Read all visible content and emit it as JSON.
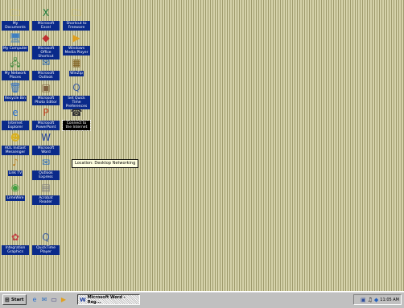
{
  "desktop": {
    "icons": [
      {
        "label": "My Documents",
        "glyph": "🗀",
        "color": "#e8c840"
      },
      {
        "label": "My Computer",
        "glyph": "🖥",
        "color": "#4080c0"
      },
      {
        "label": "My Network Places",
        "glyph": "🖧",
        "color": "#3a8a3a"
      },
      {
        "label": "Recycle Bin",
        "glyph": "🗑",
        "color": "#2b6cc4"
      },
      {
        "label": "Internet Explorer",
        "glyph": "e",
        "color": "#2a6fd0"
      },
      {
        "label": "AOL Instant Messenger",
        "glyph": "☻",
        "color": "#d8b020"
      },
      {
        "label": "Link TV",
        "glyph": "♪",
        "color": "#c08020"
      },
      {
        "label": "LimeWire",
        "glyph": "◉",
        "color": "#40a040"
      },
      {
        "label": "Integration Graphics",
        "glyph": "✿",
        "color": "#c04040"
      },
      {
        "label": "Microsoft Excel",
        "glyph": "X",
        "color": "#1a7a3a"
      },
      {
        "label": "Microsoft Office Shortcut",
        "glyph": "◆",
        "color": "#c03030"
      },
      {
        "label": "Microsoft Outlook",
        "glyph": "✉",
        "color": "#2060b0"
      },
      {
        "label": "Microsoft Photo Editor",
        "glyph": "▣",
        "color": "#806040"
      },
      {
        "label": "Microsoft PowerPoint",
        "glyph": "P",
        "color": "#c04020"
      },
      {
        "label": "Microsoft Word",
        "glyph": "W",
        "color": "#2040a0"
      },
      {
        "label": "Outlook Express",
        "glyph": "✉",
        "color": "#3070c0"
      },
      {
        "label": "Acrobat Reader",
        "glyph": "▤",
        "color": "#808080"
      },
      {
        "label": "QuickTime Player",
        "glyph": "Q",
        "color": "#4060a0"
      },
      {
        "label": "Shortcut to Freeware",
        "glyph": "🗀",
        "color": "#e8c840"
      },
      {
        "label": "Windows Media Player",
        "glyph": "▶",
        "color": "#e0a020"
      },
      {
        "label": "WinZip",
        "glyph": "▦",
        "color": "#806020"
      },
      {
        "label": "Set Quick Time Preferences",
        "glyph": "Q",
        "color": "#4060a0"
      },
      {
        "label": "Connect to the Internet",
        "glyph": "☎",
        "color": "#303030"
      }
    ],
    "tooltip": "Location: Desktop Networking"
  },
  "taskbar": {
    "start_label": "Start",
    "quick_launch": [
      "ie-icon",
      "outlook-icon",
      "desktop-icon",
      "media-icon"
    ],
    "task_label": "Microsoft Word - Reg...",
    "clock": "11:05 AM"
  },
  "colors": {
    "desktop_bg": "#c8c59a",
    "label_bg": "#0a2a8a",
    "taskbar": "#c0c0c0"
  }
}
